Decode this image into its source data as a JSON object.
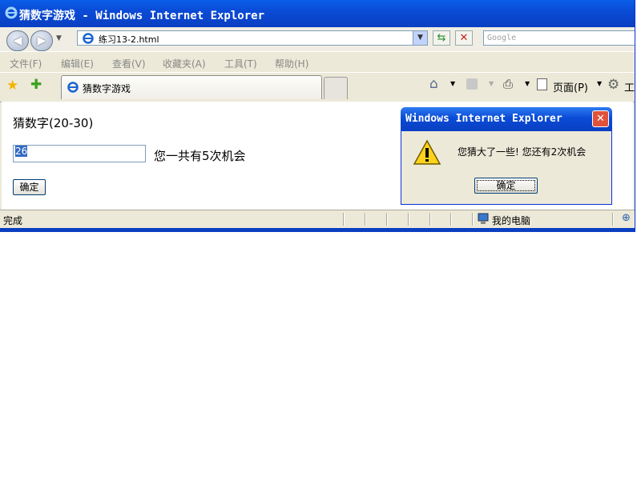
{
  "window": {
    "title": "猜数字游戏 - Windows Internet Explorer"
  },
  "nav": {
    "address": "练习13-2.html",
    "search_placeholder": "Google"
  },
  "menu": [
    "文件(F)",
    "编辑(E)",
    "查看(V)",
    "收藏夹(A)",
    "工具(T)",
    "帮助(H)"
  ],
  "tab": {
    "label": "猜数字游戏"
  },
  "toolbar": {
    "page_label": "页面(P)",
    "tools_label": "工"
  },
  "page": {
    "heading": "猜数字(20-30)",
    "input_value": "26",
    "chances_text": "您一共有5次机会",
    "submit_label": "确定"
  },
  "status": {
    "text": "完成",
    "zone": "我的电脑"
  },
  "dialog": {
    "title": "Windows Internet Explorer",
    "message": "您猜大了一些! 您还有2次机会",
    "ok_label": "确定"
  },
  "colors": {
    "titlebar": "#0a4bd6",
    "selection": "#316ac5"
  }
}
